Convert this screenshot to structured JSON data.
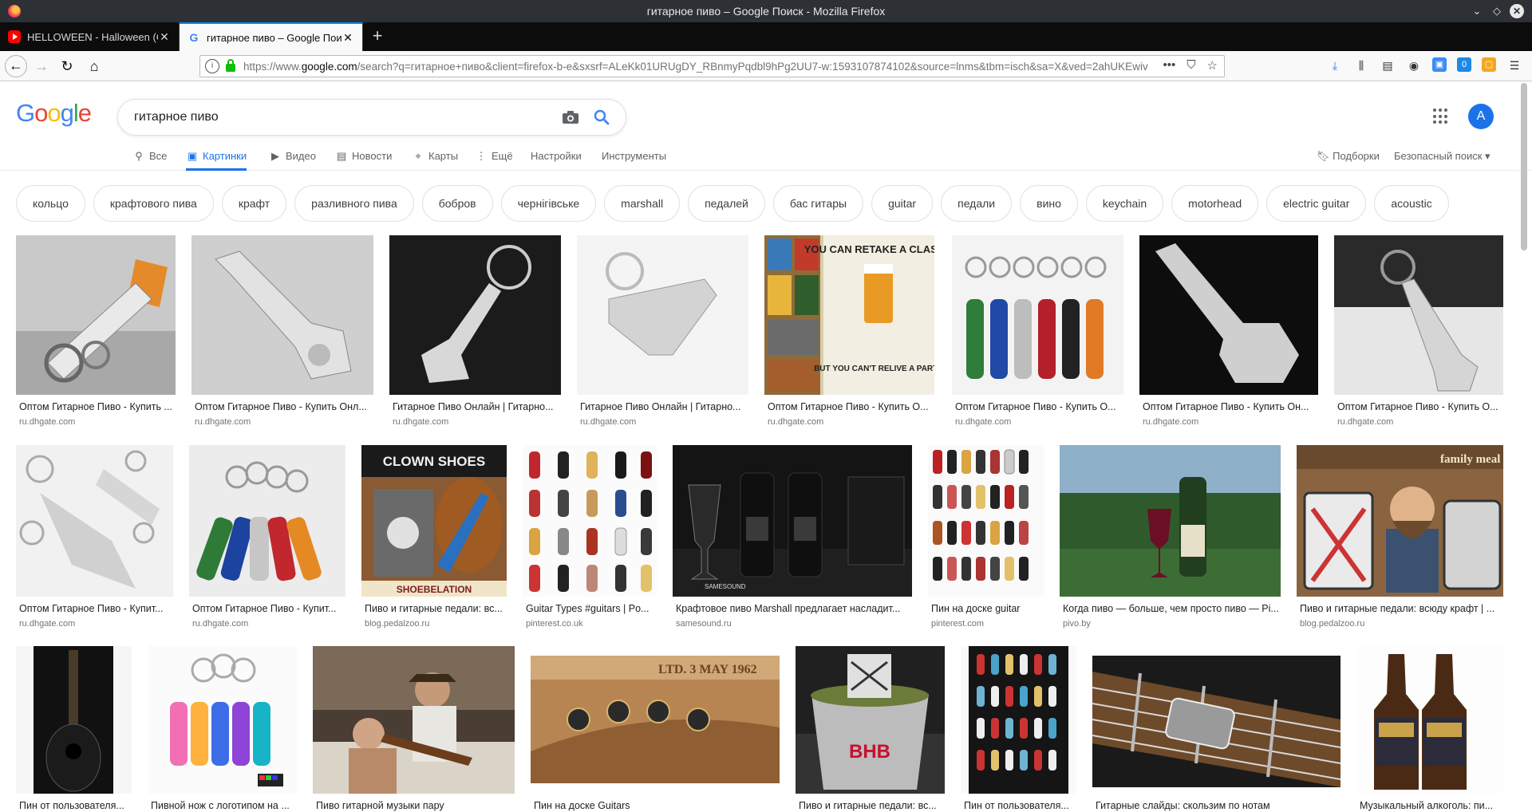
{
  "window": {
    "title": "гитарное пиво – Google Поиск - Mozilla Firefox"
  },
  "tabs": [
    {
      "label": "HELLOWEEN - Halloween (O",
      "icon": "youtube-icon"
    },
    {
      "label": "гитарное пиво – Google Поиск",
      "icon": "google-icon"
    }
  ],
  "nav": {
    "url_prefix": "https://www.",
    "url_domain": "google.com",
    "url_rest": "/search?q=гитарное+пиво&client=firefox-b-e&sxsrf=ALeKk01URUgDY_RBnmyPqdbl9hPg2UU7-w:1593107874102&source=lnms&tbm=isch&sa=X&ved=2ahUKEwiv"
  },
  "google": {
    "logo_letters": [
      "G",
      "o",
      "o",
      "g",
      "l",
      "e"
    ],
    "query": "гитарное пиво",
    "avatar_letter": "A",
    "tabs": [
      {
        "label": "Все",
        "icon": "search-icon"
      },
      {
        "label": "Картинки",
        "icon": "image-icon"
      },
      {
        "label": "Видео",
        "icon": "video-icon"
      },
      {
        "label": "Новости",
        "icon": "news-icon"
      },
      {
        "label": "Карты",
        "icon": "map-pin-icon"
      },
      {
        "label": "Ещё",
        "icon": "more-vert-icon"
      },
      {
        "label": "Настройки"
      },
      {
        "label": "Инструменты"
      }
    ],
    "collections": "Подборки",
    "safesearch": "Безопасный поиск ▾"
  },
  "chips": [
    "кольцо",
    "крафтового пива",
    "крафт",
    "разливного пива",
    "бобров",
    "чернігівське",
    "marshall",
    "педалей",
    "бас гитары",
    "guitar",
    "педали",
    "вино",
    "keychain",
    "motorhead",
    "electric guitar",
    "acoustic"
  ],
  "results": [
    [
      {
        "caption": "Оптом Гитарное Пиво - Купить ...",
        "source": "ru.dhgate.com"
      },
      {
        "caption": "Оптом Гитарное Пиво - Купить Онл...",
        "source": "ru.dhgate.com"
      },
      {
        "caption": "Гитарное Пиво Онлайн | Гитарно...",
        "source": "ru.dhgate.com"
      },
      {
        "caption": "Гитарное Пиво Онлайн | Гитарно...",
        "source": "ru.dhgate.com"
      },
      {
        "caption": "Оптом Гитарное Пиво - Купить О...",
        "source": "ru.dhgate.com"
      },
      {
        "caption": "Оптом Гитарное Пиво - Купить О...",
        "source": "ru.dhgate.com"
      },
      {
        "caption": "Оптом Гитарное Пиво - Купить Он...",
        "source": "ru.dhgate.com"
      },
      {
        "caption": "Оптом Гитарное Пиво - Купить О...",
        "source": "ru.dhgate.com"
      }
    ],
    [
      {
        "caption": "Оптом Гитарное Пиво - Купит...",
        "source": "ru.dhgate.com"
      },
      {
        "caption": "Оптом Гитарное Пиво - Купит...",
        "source": "ru.dhgate.com"
      },
      {
        "caption": "Пиво и гитарные педали: вс...",
        "source": "blog.pedalzoo.ru"
      },
      {
        "caption": "Guitar Types #guitars | Po...",
        "source": "pinterest.co.uk"
      },
      {
        "caption": "Крафтовое пиво Marshall предлагает насладит...",
        "source": "samesound.ru"
      },
      {
        "caption": "Пин на доске guitar",
        "source": "pinterest.com"
      },
      {
        "caption": "Когда пиво — больше, чем просто пиво — Pi...",
        "source": "pivo.by"
      },
      {
        "caption": "Пиво и гитарные педали: всюду крафт | ...",
        "source": "blog.pedalzoo.ru"
      }
    ],
    [
      {
        "caption": "Пин от пользователя..."
      },
      {
        "caption": "Пивной нож с логотипом на ..."
      },
      {
        "caption": "Пиво гитарной музыки пару"
      },
      {
        "caption": "Пин на доске Guitars"
      },
      {
        "caption": "Пиво и гитарные педали: вс..."
      },
      {
        "caption": "Пин от пользователя..."
      },
      {
        "caption": "Гитарные слайды: скользим по нотам"
      },
      {
        "caption": "Музыкальный алкоголь: пи..."
      }
    ]
  ],
  "image_texts": {
    "r1_5_top": "YOU CAN RETAKE A CLASS...",
    "r1_5_bottom": "BUT YOU CAN'T RELIVE A PARTY",
    "r2_3_top": "CLOWN SHOES",
    "r2_3_bottom": "SHOEBELATION",
    "r2_5_label": "SAMESOUND",
    "r2_8_label": "family meal",
    "r3_5_label": "BHB",
    "r3_4_label": "LTD. 3 MAY 1962"
  }
}
